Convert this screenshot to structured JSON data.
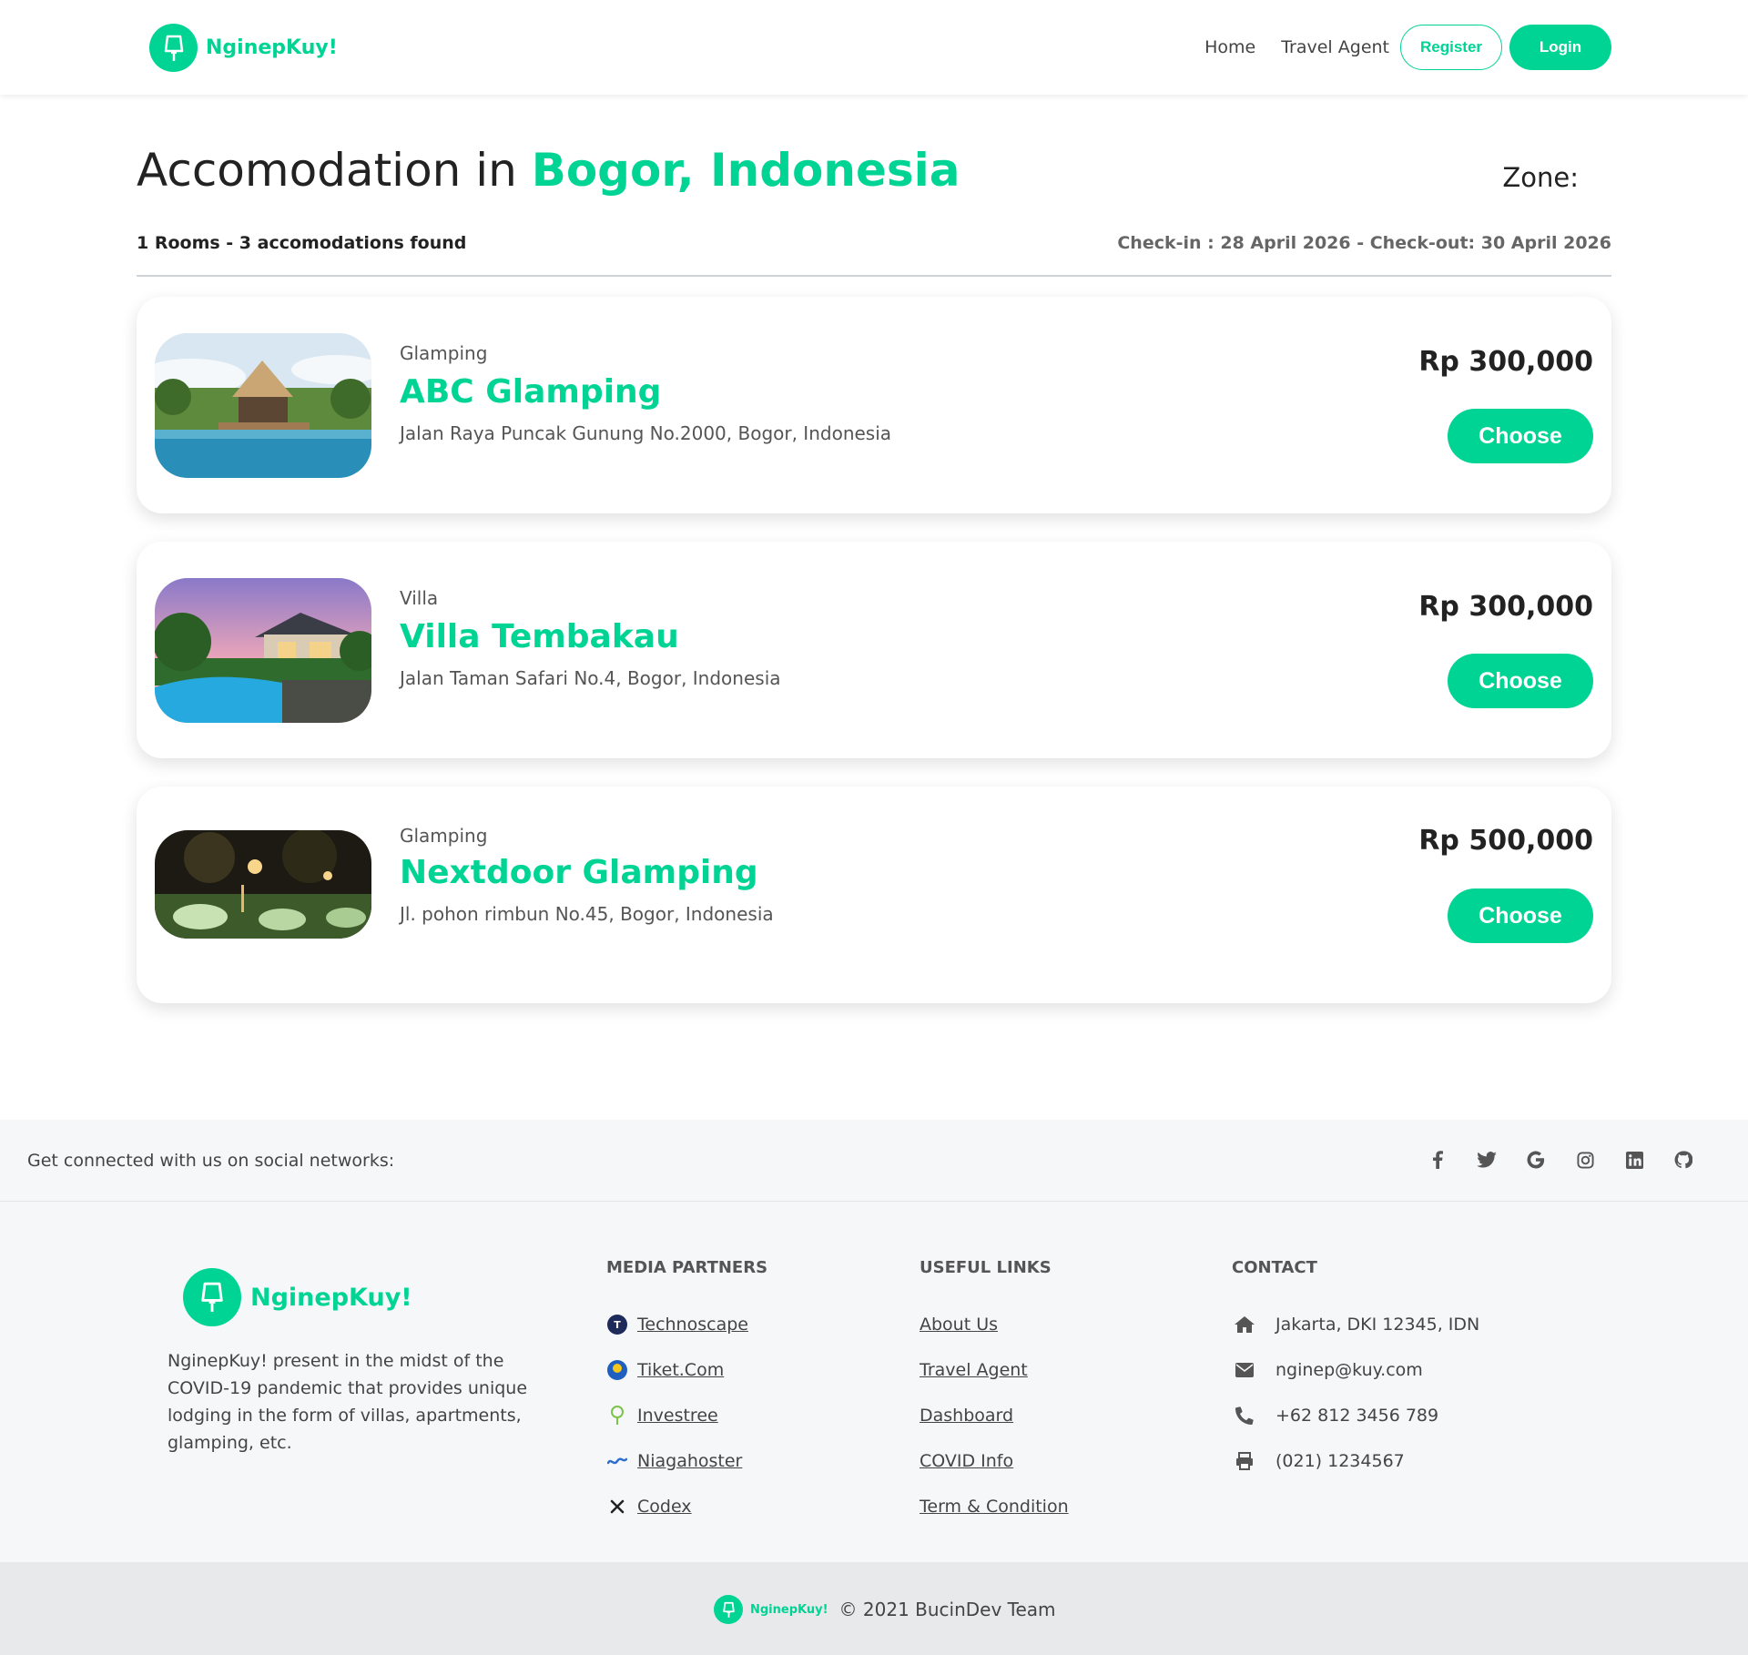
{
  "nav": {
    "brand": "NginepKuy!",
    "links": [
      "Home",
      "Travel Agent"
    ],
    "register": "Register",
    "login": "Login"
  },
  "header": {
    "title_prefix": "Accomodation in ",
    "title_location": "Bogor, Indonesia",
    "zone_label": "Zone:",
    "summary": "1 Rooms - 3 accomodations found",
    "dates": "Check-in : 28 April 2026 - Check-out: 30 April 2026"
  },
  "results": [
    {
      "type": "Glamping",
      "name": "ABC Glamping",
      "address": "Jalan Raya Puncak Gunung No.2000, Bogor, Indonesia",
      "price": "Rp 300,000",
      "button": "Choose"
    },
    {
      "type": "Villa",
      "name": "Villa Tembakau",
      "address": "Jalan Taman Safari No.4, Bogor, Indonesia",
      "price": "Rp 300,000",
      "button": "Choose"
    },
    {
      "type": "Glamping",
      "name": "Nextdoor Glamping",
      "address": "Jl. pohon rimbun No.45, Bogor, Indonesia",
      "price": "Rp 500,000",
      "button": "Choose"
    }
  ],
  "social": {
    "text": "Get connected with us on social networks:",
    "icons": [
      "facebook-icon",
      "twitter-icon",
      "google-icon",
      "instagram-icon",
      "linkedin-icon",
      "github-icon"
    ]
  },
  "footer": {
    "brand": "NginepKuy!",
    "description": "NginepKuy! present in the midst of the COVID-19 pandemic that provides unique lodging in the form of villas, apartments, glamping, etc.",
    "media_title": "MEDIA PARTNERS",
    "media": [
      "Technoscape",
      "Tiket.Com",
      "Investree",
      "Niagahoster",
      "Codex"
    ],
    "links_title": "USEFUL LINKS",
    "links": [
      "About Us",
      "Travel Agent",
      "Dashboard",
      "COVID Info",
      "Term & Condition"
    ],
    "contact_title": "CONTACT",
    "contact": {
      "address": "Jakarta, DKI 12345, IDN",
      "email": "nginep@kuy.com",
      "phone": "+62 812 3456 789",
      "fax": "(021) 1234567"
    }
  },
  "bottom": {
    "brand": "NginepKuy!",
    "copyright": "© 2021 BucinDev Team"
  },
  "colors": {
    "accent": "#00d494",
    "text": "#222222",
    "muted": "#555555",
    "footer_bg": "#f6f7f9",
    "bottom_bg": "#e8e9eb"
  }
}
